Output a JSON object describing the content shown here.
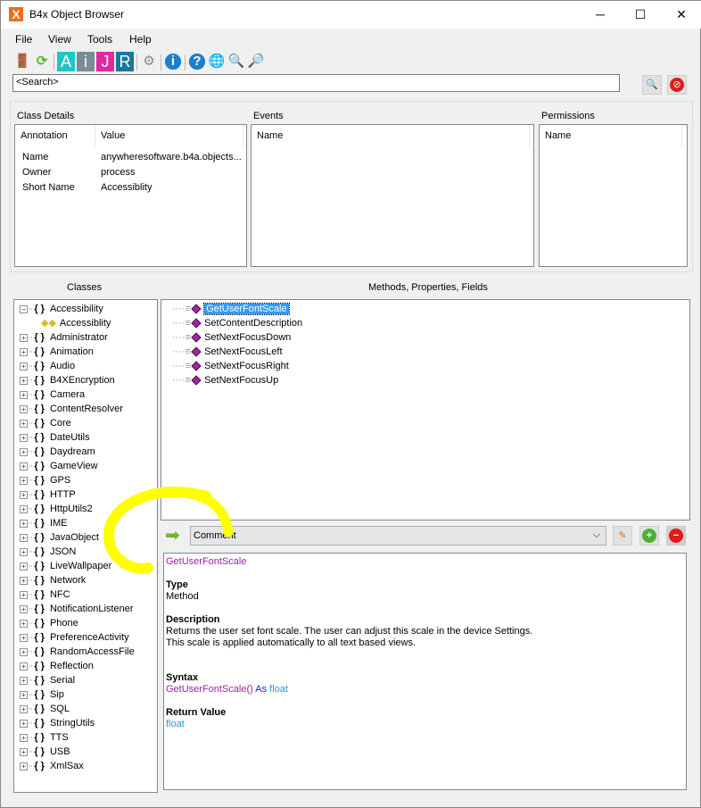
{
  "window": {
    "title": "B4x Object Browser",
    "app_icon": "X",
    "minimize": "─",
    "maximize": "☐",
    "close": "✕"
  },
  "menu": [
    "File",
    "View",
    "Tools",
    "Help"
  ],
  "toolbar": [
    {
      "name": "exit-icon",
      "glyph": "🚪"
    },
    {
      "name": "refresh-icon",
      "glyph": "⟳"
    },
    {
      "name": "android-A-icon",
      "glyph": "A"
    },
    {
      "name": "ios-i-icon",
      "glyph": "i"
    },
    {
      "name": "java-J-icon",
      "glyph": "J"
    },
    {
      "name": "b4r-R-icon",
      "glyph": "R"
    },
    {
      "name": "settings-icon",
      "glyph": "⚙"
    },
    {
      "name": "info-icon",
      "glyph": "i"
    },
    {
      "name": "help-icon",
      "glyph": "?"
    },
    {
      "name": "globe-icon",
      "glyph": "🌐"
    },
    {
      "name": "search-icon",
      "glyph": "🔍"
    },
    {
      "name": "search-file-icon",
      "glyph": "🔎"
    }
  ],
  "search": {
    "value": "<Search>"
  },
  "class_details": {
    "title": "Class Details",
    "headers": [
      "Annotation",
      "Value"
    ],
    "rows": [
      [
        "Name",
        "anywheresoftware.b4a.objects..."
      ],
      [
        "Owner",
        "process"
      ],
      [
        "Short Name",
        "Accessiblity"
      ]
    ]
  },
  "events": {
    "title": "Events",
    "header": "Name"
  },
  "permissions": {
    "title": "Permissions",
    "header": "Name"
  },
  "classes_label": "Classes",
  "methods_label": "Methods, Properties, Fields",
  "classes": [
    {
      "name": "Accessibility",
      "expanded": true,
      "child": "Accessiblity"
    },
    {
      "name": "Administrator"
    },
    {
      "name": "Animation"
    },
    {
      "name": "Audio"
    },
    {
      "name": "B4XEncryption"
    },
    {
      "name": "Camera"
    },
    {
      "name": "ContentResolver"
    },
    {
      "name": "Core"
    },
    {
      "name": "DateUtils"
    },
    {
      "name": "Daydream"
    },
    {
      "name": "GameView"
    },
    {
      "name": "GPS"
    },
    {
      "name": "HTTP"
    },
    {
      "name": "HttpUtils2"
    },
    {
      "name": "IME"
    },
    {
      "name": "JavaObject"
    },
    {
      "name": "JSON"
    },
    {
      "name": "LiveWallpaper"
    },
    {
      "name": "Network"
    },
    {
      "name": "NFC"
    },
    {
      "name": "NotificationListener"
    },
    {
      "name": "Phone"
    },
    {
      "name": "PreferenceActivity"
    },
    {
      "name": "RandomAccessFile"
    },
    {
      "name": "Reflection"
    },
    {
      "name": "Serial"
    },
    {
      "name": "Sip"
    },
    {
      "name": "SQL"
    },
    {
      "name": "StringUtils"
    },
    {
      "name": "TTS"
    },
    {
      "name": "USB"
    },
    {
      "name": "XmlSax"
    }
  ],
  "methods": [
    "GetUserFontScale",
    "SetContentDescription",
    "SetNextFocusDown",
    "SetNextFocusLeft",
    "SetNextFocusRight",
    "SetNextFocusUp"
  ],
  "selected_method": "GetUserFontScale",
  "comment_select": "Comment",
  "details": {
    "name": "GetUserFontScale",
    "type_label": "Type",
    "type": "Method",
    "desc_label": "Description",
    "desc1": "Returns the user set font scale. The user can adjust this scale in the device Settings.",
    "desc2": "This scale is applied automatically to all text based views.",
    "syntax_label": "Syntax",
    "syntax_name": "GetUserFontScale()",
    "syntax_as": "As",
    "syntax_type": "float",
    "return_label": "Return Value",
    "return_type": "float"
  },
  "colors": {
    "accent": "#3399ff",
    "annotation": "#ffff00",
    "purple": "#a020a0"
  }
}
